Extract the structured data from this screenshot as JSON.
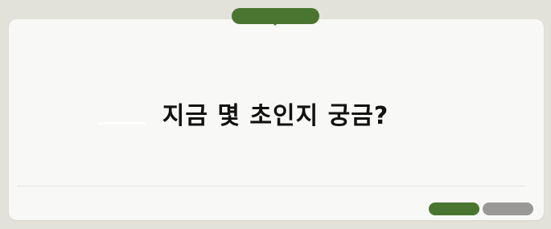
{
  "question": {
    "text": "지금 몇 초인지 궁금?"
  },
  "colors": {
    "page_background": "#e3e2da",
    "card_background": "#f8f8f6",
    "accent_green": "#4a7530",
    "secondary_gray": "#9a9896",
    "text": "#111111"
  },
  "top_tab": {
    "label": ""
  },
  "actions": {
    "primary_label": "",
    "secondary_label": ""
  }
}
